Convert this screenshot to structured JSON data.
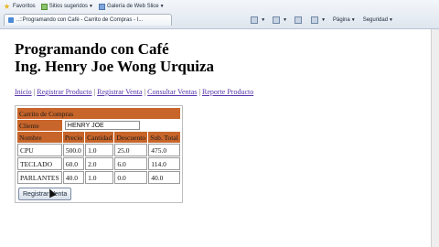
{
  "browser": {
    "favorites": "Favoritos",
    "suggested_sites": "Sitios sugeridos",
    "web_slice_gallery": "Galería de Web Slice",
    "tab_title": "..::Programando con Café - Carrito de Compras - I...",
    "page_menu": "Página",
    "safety_menu": "Seguridad"
  },
  "header": {
    "line1": "Programando con Café",
    "line2": "Ing. Henry Joe Wong Urquiza"
  },
  "nav": {
    "items": [
      "Inicio",
      "Registrar Producto",
      "Registrar Venta",
      "Consultar Ventas",
      "Reporte Producto"
    ],
    "separator": "|"
  },
  "cart": {
    "title": "Carrito de Compras",
    "client_label": "Cliente",
    "client_value": "HENRY JOE",
    "columns": [
      "Nombre",
      "Precio",
      "Cantidad",
      "Descuento",
      "Sub. Total"
    ],
    "rows": [
      [
        "CPU",
        "500.0",
        "1.0",
        "25.0",
        "475.0"
      ],
      [
        "TECLADO",
        "60.0",
        "2.0",
        "6.0",
        "114.0"
      ],
      [
        "PARLANTES",
        "40.0",
        "1.0",
        "0.0",
        "40.0"
      ]
    ],
    "button_label": "Registrar Venta"
  },
  "colors": {
    "header_cell": "#c8652a",
    "link": "#5533aa"
  }
}
